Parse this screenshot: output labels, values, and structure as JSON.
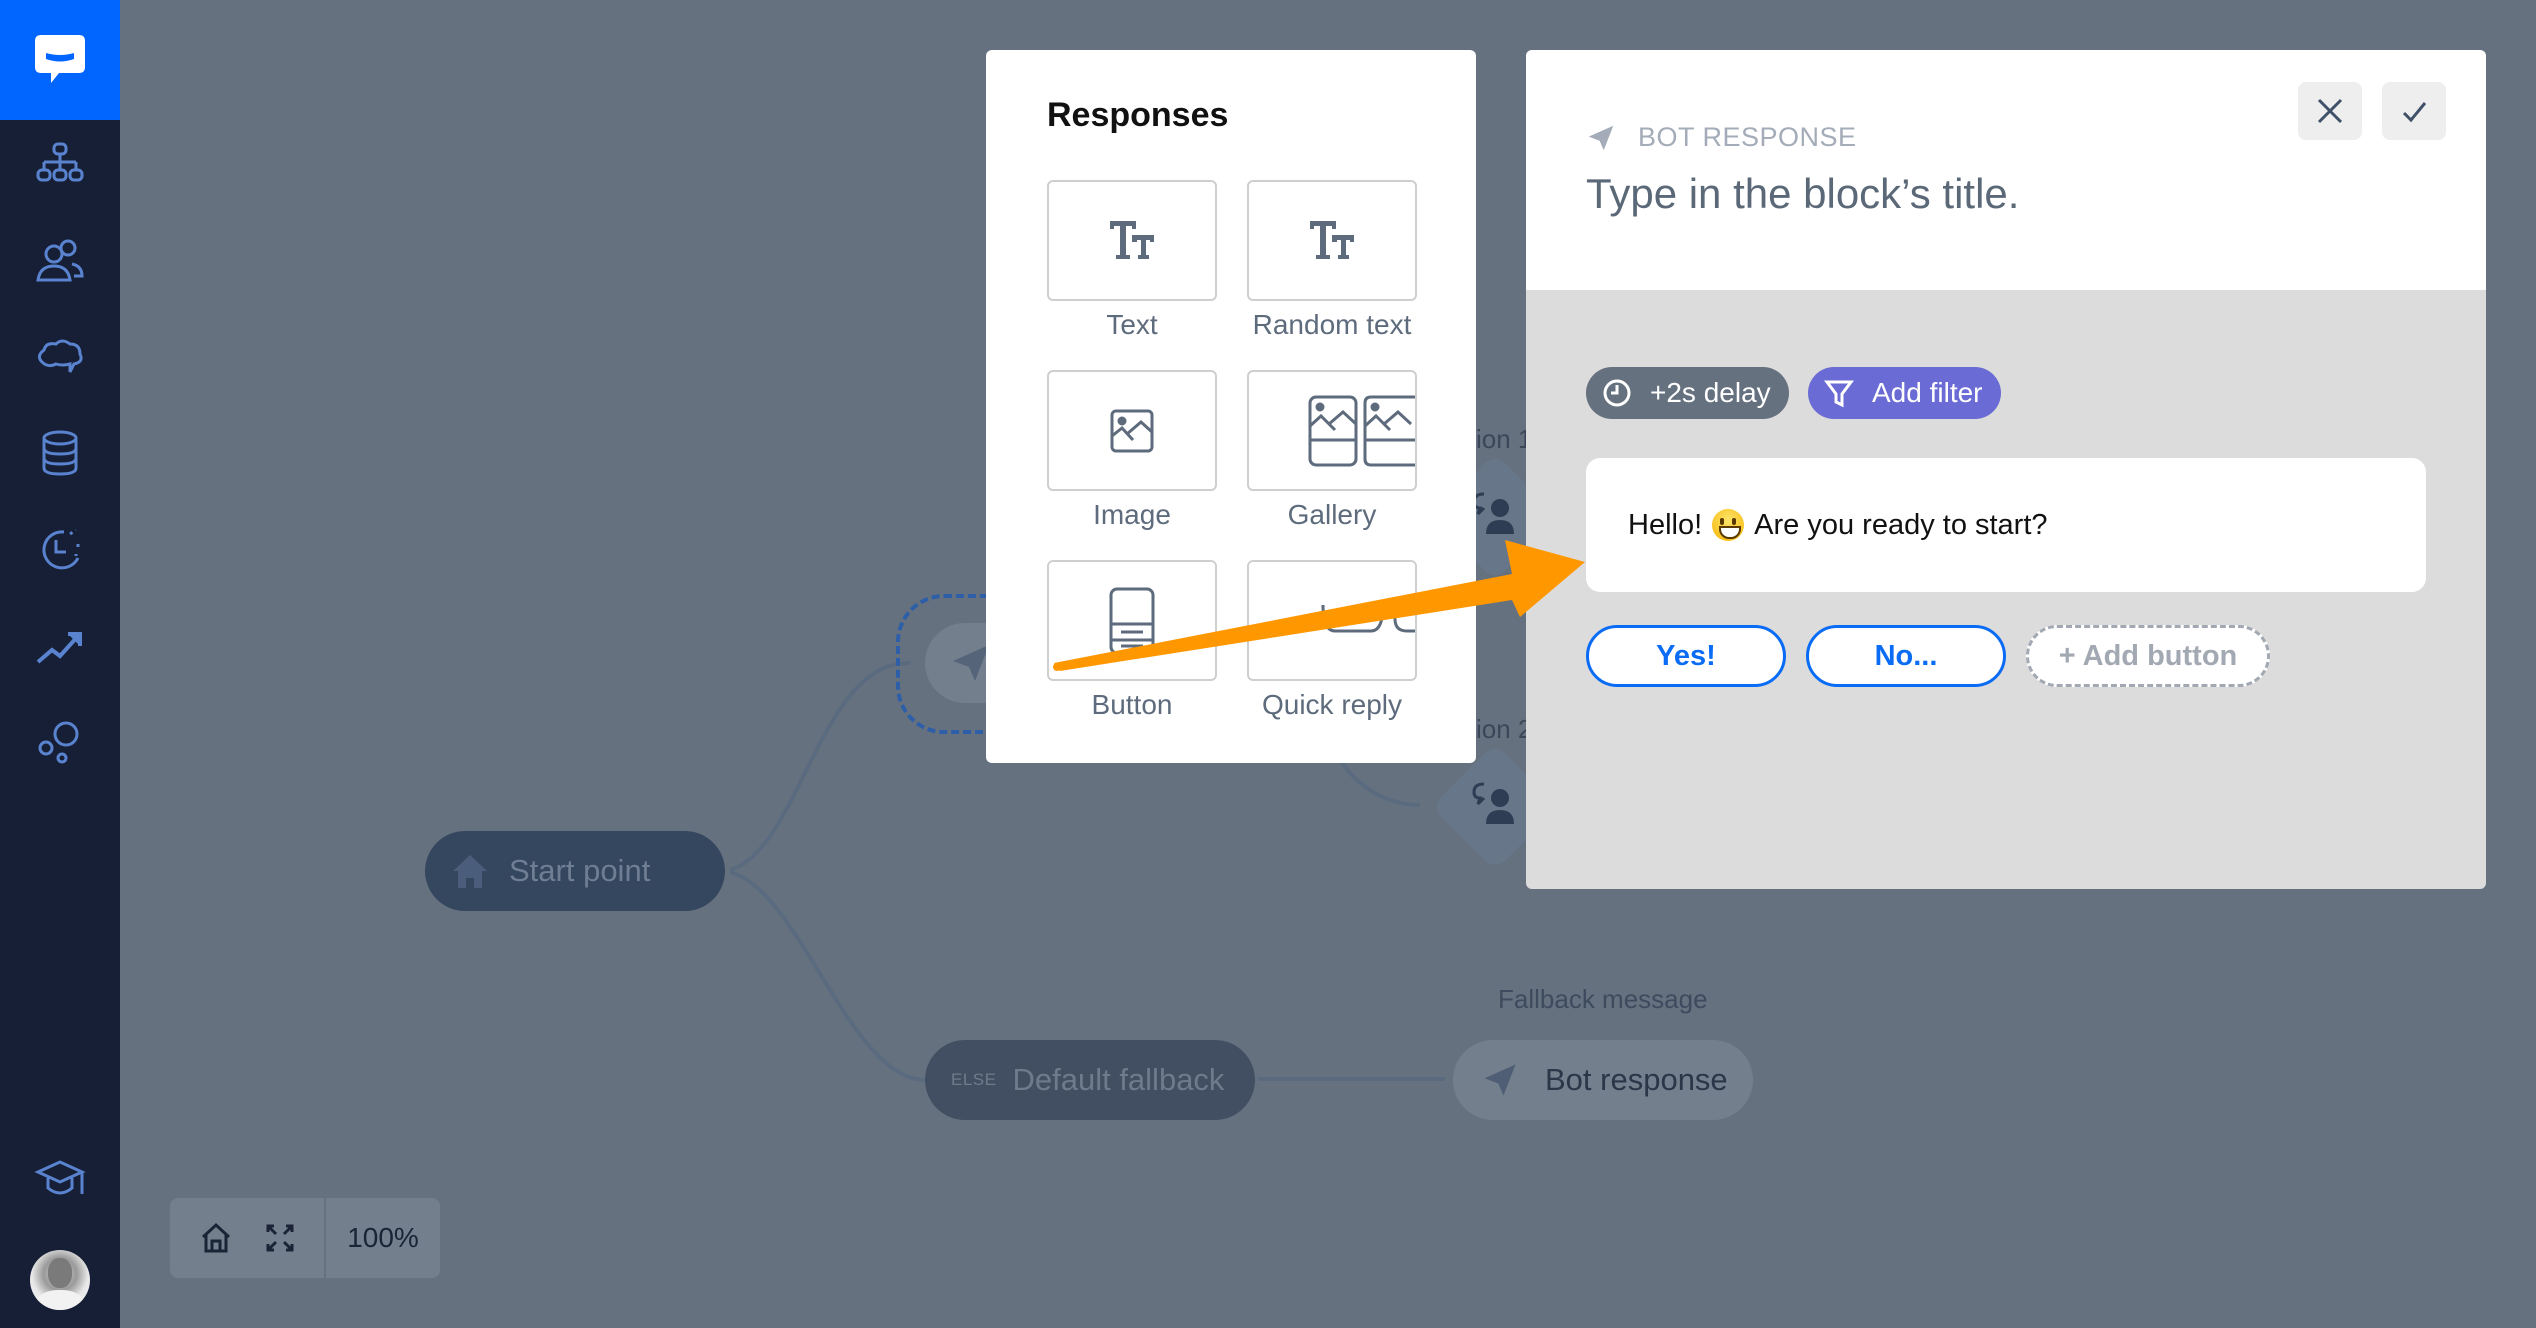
{
  "sidebar": {
    "logo": {
      "icon": "chat-bubble-logo-icon",
      "color": "#0066ff"
    },
    "items": [
      {
        "name": "stories",
        "icon": "sitemap-icon"
      },
      {
        "name": "audience",
        "icon": "users-icon"
      },
      {
        "name": "training",
        "icon": "brain-icon"
      },
      {
        "name": "data",
        "icon": "database-icon"
      },
      {
        "name": "history",
        "icon": "clock-history-icon"
      },
      {
        "name": "reports",
        "icon": "trend-up-icon"
      },
      {
        "name": "integrations",
        "icon": "bubbles-icon"
      }
    ],
    "bottom": [
      {
        "name": "academy",
        "icon": "graduation-cap-icon"
      },
      {
        "name": "profile",
        "icon": "avatar"
      }
    ]
  },
  "canvas": {
    "start_node": {
      "label": "Start point",
      "icon": "home-icon"
    },
    "fallback_node": {
      "prefix": "ELSE",
      "label": "Default fallback"
    },
    "fallback_caption": "Fallback message",
    "fallback_response_node": {
      "label": "Bot response",
      "icon": "paper-plane-icon"
    },
    "option_labels": [
      "ion 1",
      "ion 2"
    ],
    "zoom": {
      "home": "home-icon",
      "fit": "expand-icon",
      "level": "100%"
    }
  },
  "responses_panel": {
    "title": "Responses",
    "tiles": [
      {
        "label": "Text",
        "icon": "text-format-icon"
      },
      {
        "label": "Random text",
        "icon": "text-format-icon"
      },
      {
        "label": "Image",
        "icon": "image-icon"
      },
      {
        "label": "Gallery",
        "icon": "gallery-icon"
      },
      {
        "label": "Button",
        "icon": "button-card-icon"
      },
      {
        "label": "Quick reply",
        "icon": "quick-reply-icon"
      }
    ]
  },
  "bot_response_panel": {
    "type_label": "BOT RESPONSE",
    "title_placeholder": "Type in the block’s title.",
    "title_value": "",
    "close_icon": "close-icon",
    "confirm_icon": "check-icon",
    "delay_chip": "+2s delay",
    "filter_chip": "Add filter",
    "message": {
      "before_emoji": "Hello!",
      "emoji": "grinning-face",
      "after_emoji": "Are you ready to start?"
    },
    "buttons": [
      "Yes!",
      "No..."
    ],
    "add_button_label": "+ Add button",
    "colors": {
      "button_border": "#0a6cf5",
      "filter_chip": "#6b6bd6",
      "delay_chip": "#66717f"
    }
  },
  "annotation": {
    "type": "arrow",
    "color": "#ff9800",
    "from": "button-tile",
    "to": "message-bubble"
  }
}
